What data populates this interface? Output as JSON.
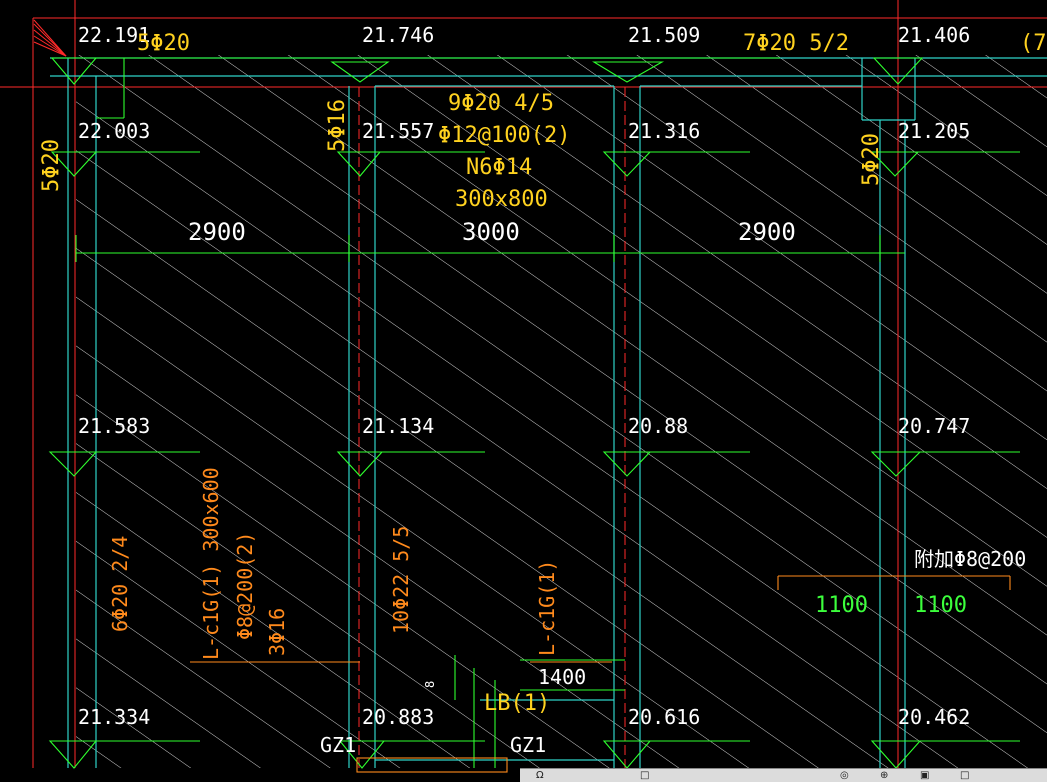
{
  "drawing": {
    "colors": {
      "background": "#000000",
      "beam_cyan": "#2fd3c8",
      "dim_green": "#2eff2e",
      "border_red": "#ff2a2a",
      "text_white": "#ffffff",
      "text_yellow": "#ffd21f",
      "text_orange": "#ff8a1c",
      "hatch": "#d8d8d8"
    },
    "elevations": {
      "r1": [
        "22.191",
        "21.746",
        "21.509",
        "21.406"
      ],
      "r2": [
        "22.003",
        "21.557",
        "21.316",
        "21.205"
      ],
      "r3": [
        "21.583",
        "21.134",
        "20.88",
        "20.747"
      ],
      "r4": [
        "21.334",
        "20.883",
        "20.616",
        "20.462"
      ]
    },
    "spans": [
      "2900",
      "3000",
      "2900"
    ],
    "top_rebar": {
      "left": "5Φ20",
      "right": "7Φ20 5/2",
      "far_right": "(7"
    },
    "beam_label": {
      "line1": "9Φ20 4/5",
      "line2": "Φ12@100(2)",
      "line3": "N6Φ14",
      "line4": "300x800"
    },
    "side_rebar": {
      "left_edge": "5Φ20",
      "col2": "5Φ16",
      "col4": "5Φ20"
    },
    "lower_labels": {
      "bottom_left": "6Φ20 2/4",
      "beam_name": "L-c1G(1) 300x600",
      "stirrup": "Φ8@200(2)",
      "side": "3Φ16",
      "middle": "10Φ22 5/5",
      "beam_name_2": "L-c1G(1)",
      "dim_1400": "1400",
      "lb": "LB(1)",
      "gz_left": "GZ1",
      "gz_right": "GZ1",
      "small_mark": "8"
    },
    "right_note": {
      "text": "附加Φ8@200",
      "dim_a": "1100",
      "dim_b": "1100"
    }
  },
  "statusbar": {
    "items": [
      "Ω",
      "□",
      "◎",
      "⊕",
      "▣",
      "□"
    ]
  }
}
